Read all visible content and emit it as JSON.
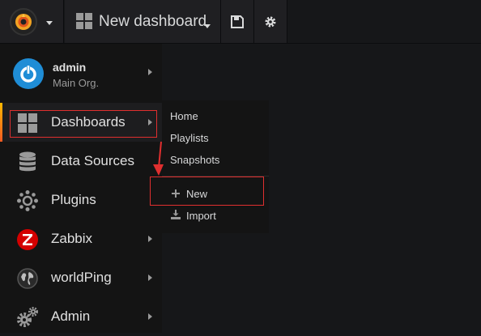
{
  "topbar": {
    "dashboard_title": "New dashboard"
  },
  "user": {
    "name": "admin",
    "org": "Main Org."
  },
  "sidemenu": {
    "items": [
      {
        "label": "Dashboards",
        "icon": "dashboards-grid-icon"
      },
      {
        "label": "Data Sources",
        "icon": "database-icon"
      },
      {
        "label": "Plugins",
        "icon": "plugins-icon"
      },
      {
        "label": "Zabbix",
        "icon": "zabbix-icon"
      },
      {
        "label": "worldPing",
        "icon": "globe-icon"
      },
      {
        "label": "Admin",
        "icon": "gears-icon"
      }
    ]
  },
  "submenu": {
    "items": [
      {
        "label": "Home"
      },
      {
        "label": "Playlists"
      },
      {
        "label": "Snapshots"
      },
      {
        "label": "New",
        "icon": "plus-icon"
      },
      {
        "label": "Import",
        "icon": "import-icon"
      }
    ]
  },
  "colors": {
    "background": "#161719",
    "highlight_box": "#e02f2f",
    "active_bar": "#f15a22",
    "avatar": "#1f8dd6",
    "zabbix": "#d40000"
  }
}
